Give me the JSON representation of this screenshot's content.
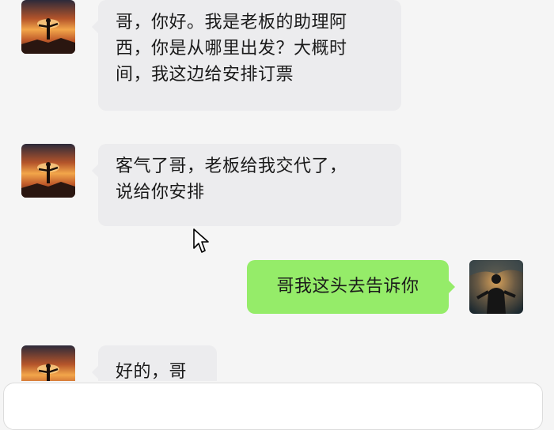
{
  "messages": [
    {
      "side": "incoming",
      "avatar": "sunset-figure-avatar",
      "text_lines": [
        "哥，你好。我是老板的助理阿",
        "西，你是从哪里出发？大概时",
        "间，我这边给安排订票"
      ]
    },
    {
      "side": "incoming",
      "avatar": "sunset-figure-avatar",
      "text_lines": [
        "客气了哥，老板给我交代了，",
        "说给你安排"
      ]
    },
    {
      "side": "outgoing",
      "avatar": "dark-figure-avatar",
      "text_lines": [
        "哥我这头去告诉你"
      ]
    },
    {
      "side": "incoming",
      "avatar": "sunset-figure-avatar",
      "text_lines": [
        "好的，哥"
      ]
    }
  ],
  "colors": {
    "incoming_bubble": "#ececee",
    "outgoing_bubble": "#95ec69",
    "background": "#f5f5f5"
  },
  "icons": [
    "cursor-arrow-icon"
  ]
}
